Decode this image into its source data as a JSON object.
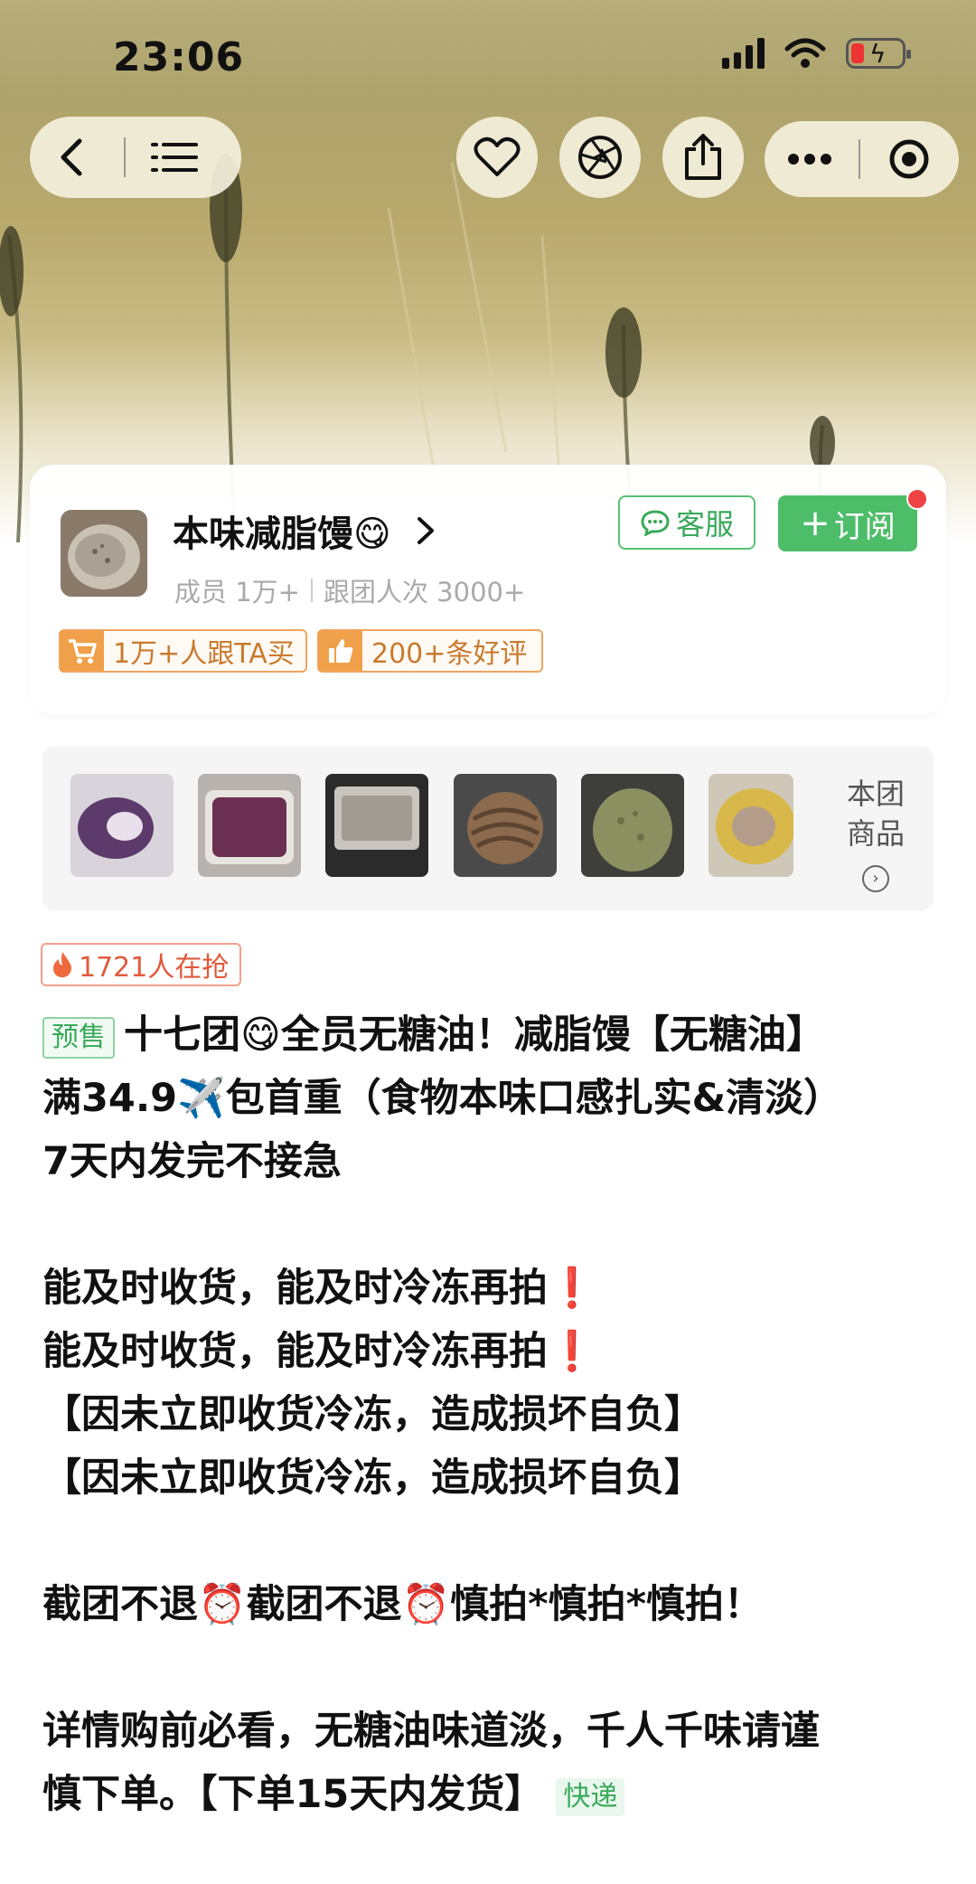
{
  "status_bar": {
    "time": "23:06"
  },
  "nav": {
    "back_icon": "chevron-left-icon",
    "menu_icon": "list-menu-icon",
    "favorite_icon": "heart-icon",
    "camera_icon": "aperture-icon",
    "share_icon": "share-icon",
    "more_icon": "more-dots-icon",
    "close_icon": "target-circle-icon"
  },
  "group": {
    "name": "本味减脂馒😋",
    "members": "成员 1万+",
    "followers": "跟团人次 3000+",
    "service_label": "客服",
    "subscribe_label": "订阅",
    "badge_buyers": "1万+人跟TA买",
    "badge_reviews": "200+条好评"
  },
  "products": {
    "more_line1": "本团",
    "more_line2": "商品"
  },
  "hot_tag": "1721人在抢",
  "description": {
    "presale_tag": "预售",
    "line1": "十七团😋全员无糖油！减脂馒【无糖油】",
    "line2": "满34.9✈️包首重（食物本味口感扎实&清淡）",
    "line3": "7天内发完不接急",
    "line4": "能及时收货，能及时冷冻再拍",
    "line5": "能及时收货，能及时冷冻再拍",
    "excl": "❗",
    "line6": "【因未立即收货冷冻，造成损坏自负】",
    "line7": "【因未立即收货冷冻，造成损坏自负】",
    "line8": "截团不退⏰截团不退⏰慎拍*慎拍*慎拍！",
    "line9": "详情购前必看，无糖油味道淡，千人千味请谨",
    "line10": "慎下单。【下单15天内发货】",
    "express_tag": "快递"
  },
  "colors": {
    "accent_green": "#4dbd6a",
    "badge_orange": "#f0a048",
    "hot_red": "#e05a3c"
  }
}
